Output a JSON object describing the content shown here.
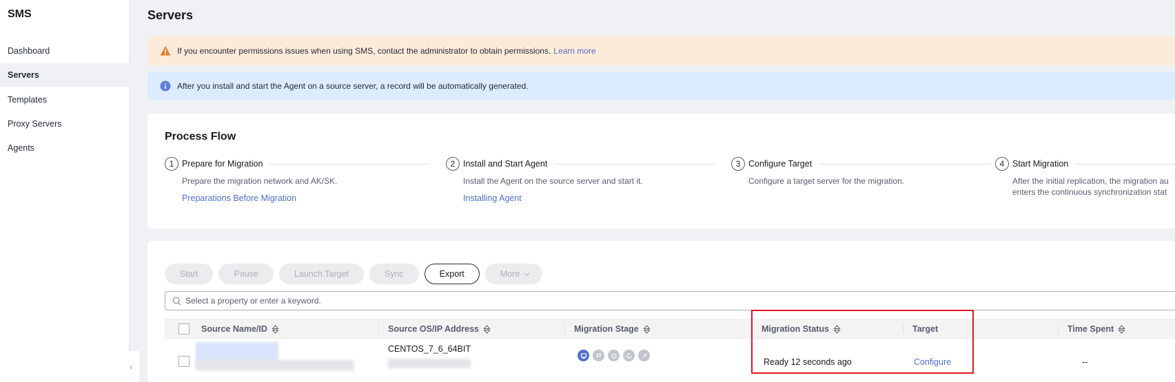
{
  "sidebar": {
    "title": "SMS",
    "items": [
      {
        "label": "Dashboard"
      },
      {
        "label": "Servers"
      },
      {
        "label": "Templates"
      },
      {
        "label": "Proxy Servers"
      },
      {
        "label": "Agents"
      }
    ],
    "active_item": "Servers"
  },
  "page": {
    "title": "Servers"
  },
  "alerts": {
    "warning": {
      "text": "If you encounter permissions issues when using SMS, contact the administrator to obtain permissions.",
      "link": "Learn more"
    },
    "info": {
      "text": "After you install and start the Agent on a source server, a record will be automatically generated."
    }
  },
  "process": {
    "title": "Process Flow",
    "steps": [
      {
        "num": "1",
        "title": "Prepare for Migration",
        "desc": "Prepare the migration network and AK/SK.",
        "link": "Preparations Before Migration"
      },
      {
        "num": "2",
        "title": "Install and Start Agent",
        "desc": "Install the Agent on the source server and start it.",
        "link": "Installing Agent"
      },
      {
        "num": "3",
        "title": "Configure Target",
        "desc": "Configure a target server for the migration.",
        "link": ""
      },
      {
        "num": "4",
        "title": "Start Migration",
        "desc": "After the initial replication, the migration au",
        "desc2": "enters the continuous synchronization stat",
        "link": ""
      }
    ]
  },
  "toolbar": {
    "buttons": [
      {
        "label": "Start",
        "enabled": false
      },
      {
        "label": "Pause",
        "enabled": false
      },
      {
        "label": "Launch Target",
        "enabled": false
      },
      {
        "label": "Sync",
        "enabled": false
      },
      {
        "label": "Export",
        "enabled": true
      },
      {
        "label": "More",
        "enabled": false
      }
    ]
  },
  "search": {
    "placeholder": "Select a property or enter a keyword."
  },
  "table": {
    "columns": [
      {
        "label": "Source Name/ID",
        "sortable": true
      },
      {
        "label": "Source OS/IP Address",
        "sortable": true
      },
      {
        "label": "Migration Stage",
        "sortable": true
      },
      {
        "label": "Migration Status",
        "sortable": true
      },
      {
        "label": "Target",
        "sortable": false
      },
      {
        "label": "Time Spent",
        "sortable": true
      }
    ],
    "rows": [
      {
        "source_os": "CENTOS_7_6_64BIT",
        "migration_status": "Ready 12 seconds ago",
        "target": "Configure",
        "time_spent": "--"
      }
    ]
  },
  "colors": {
    "accent": "#526ecc",
    "highlight": "#e0171d",
    "warning_bg": "#fdebd9",
    "info_bg": "#dcebfd"
  }
}
